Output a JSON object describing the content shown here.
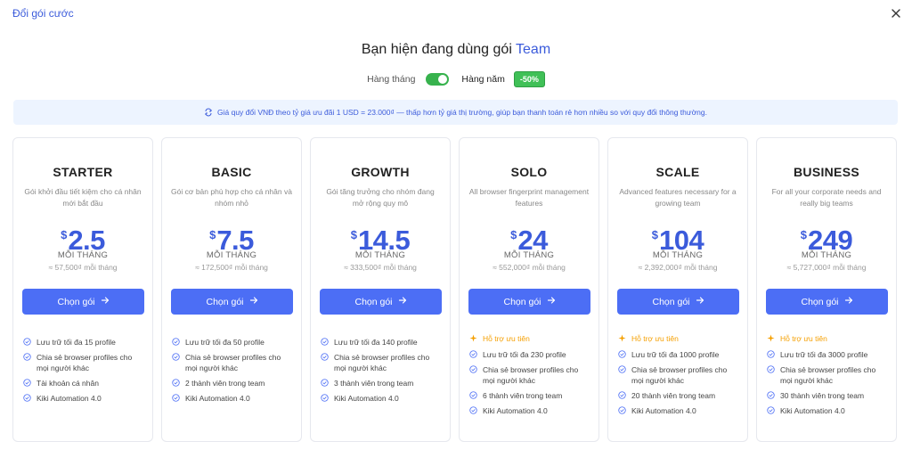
{
  "header": {
    "title": "Đổi gói cước"
  },
  "heading": {
    "prefix": "Bạn hiện đang dùng gói",
    "current_plan": "Team"
  },
  "billing": {
    "monthly_label": "Hàng tháng",
    "yearly_label": "Hàng năm",
    "discount": "-50%",
    "yearly_selected": true
  },
  "info": {
    "text": "Giá quy đổi VNĐ theo tỷ giá ưu đãi 1 USD = 23.000₫ — thấp hơn tỷ giá thị trường, giúp bạn thanh toán rẻ hơn nhiều so với quy đổi thông thường."
  },
  "colors": {
    "accent": "#4c6ef5",
    "green": "#40c057",
    "priority": "#f59f00"
  },
  "plans": [
    {
      "name": "STARTER",
      "desc": "Gói khởi đầu tiết kiệm cho cá nhân mới bắt đầu",
      "currency": "$",
      "price": "2.5",
      "per": "MỖI THÁNG",
      "vnd": "≈ 57,500₫ mỗi tháng",
      "button": "Chọn gói",
      "priority": "",
      "features": [
        "Lưu trữ tối đa 15 profile",
        "Chia sẻ browser profiles cho mọi người khác",
        "Tài khoản cá nhân",
        "Kiki Automation 4.0"
      ]
    },
    {
      "name": "BASIC",
      "desc": "Gói cơ bản phù hợp cho cá nhân và nhóm nhỏ",
      "currency": "$",
      "price": "7.5",
      "per": "MỖI THÁNG",
      "vnd": "≈ 172,500₫ mỗi tháng",
      "button": "Chọn gói",
      "priority": "",
      "features": [
        "Lưu trữ tối đa 50 profile",
        "Chia sẻ browser profiles cho mọi người khác",
        "2 thành viên trong team",
        "Kiki Automation 4.0"
      ]
    },
    {
      "name": "GROWTH",
      "desc": "Gói tăng trưởng cho nhóm đang mở rộng quy mô",
      "currency": "$",
      "price": "14.5",
      "per": "MỖI THÁNG",
      "vnd": "≈ 333,500₫ mỗi tháng",
      "button": "Chọn gói",
      "priority": "",
      "features": [
        "Lưu trữ tối đa 140 profile",
        "Chia sẻ browser profiles cho mọi người khác",
        "3 thành viên trong team",
        "Kiki Automation 4.0"
      ]
    },
    {
      "name": "SOLO",
      "desc": "All browser fingerprint management features",
      "currency": "$",
      "price": "24",
      "per": "MỖI THÁNG",
      "vnd": "≈ 552,000₫ mỗi tháng",
      "button": "Chọn gói",
      "priority": "Hỗ trợ ưu tiên",
      "features": [
        "Lưu trữ tối đa 230 profile",
        "Chia sẻ browser profiles cho mọi người khác",
        "6 thành viên trong team",
        "Kiki Automation 4.0"
      ]
    },
    {
      "name": "SCALE",
      "desc": "Advanced features necessary for a growing team",
      "currency": "$",
      "price": "104",
      "per": "MỖI THÁNG",
      "vnd": "≈ 2,392,000₫ mỗi tháng",
      "button": "Chọn gói",
      "priority": "Hỗ trợ ưu tiên",
      "features": [
        "Lưu trữ tối đa 1000 profile",
        "Chia sẻ browser profiles cho mọi người khác",
        "20 thành viên trong team",
        "Kiki Automation 4.0"
      ]
    },
    {
      "name": "BUSINESS",
      "desc": "For all your corporate needs and really big teams",
      "currency": "$",
      "price": "249",
      "per": "MỖI THÁNG",
      "vnd": "≈ 5,727,000₫ mỗi tháng",
      "button": "Chọn gói",
      "priority": "Hỗ trợ ưu tiên",
      "features": [
        "Lưu trữ tối đa 3000 profile",
        "Chia sẻ browser profiles cho mọi người khác",
        "30 thành viên trong team",
        "Kiki Automation 4.0"
      ]
    }
  ]
}
